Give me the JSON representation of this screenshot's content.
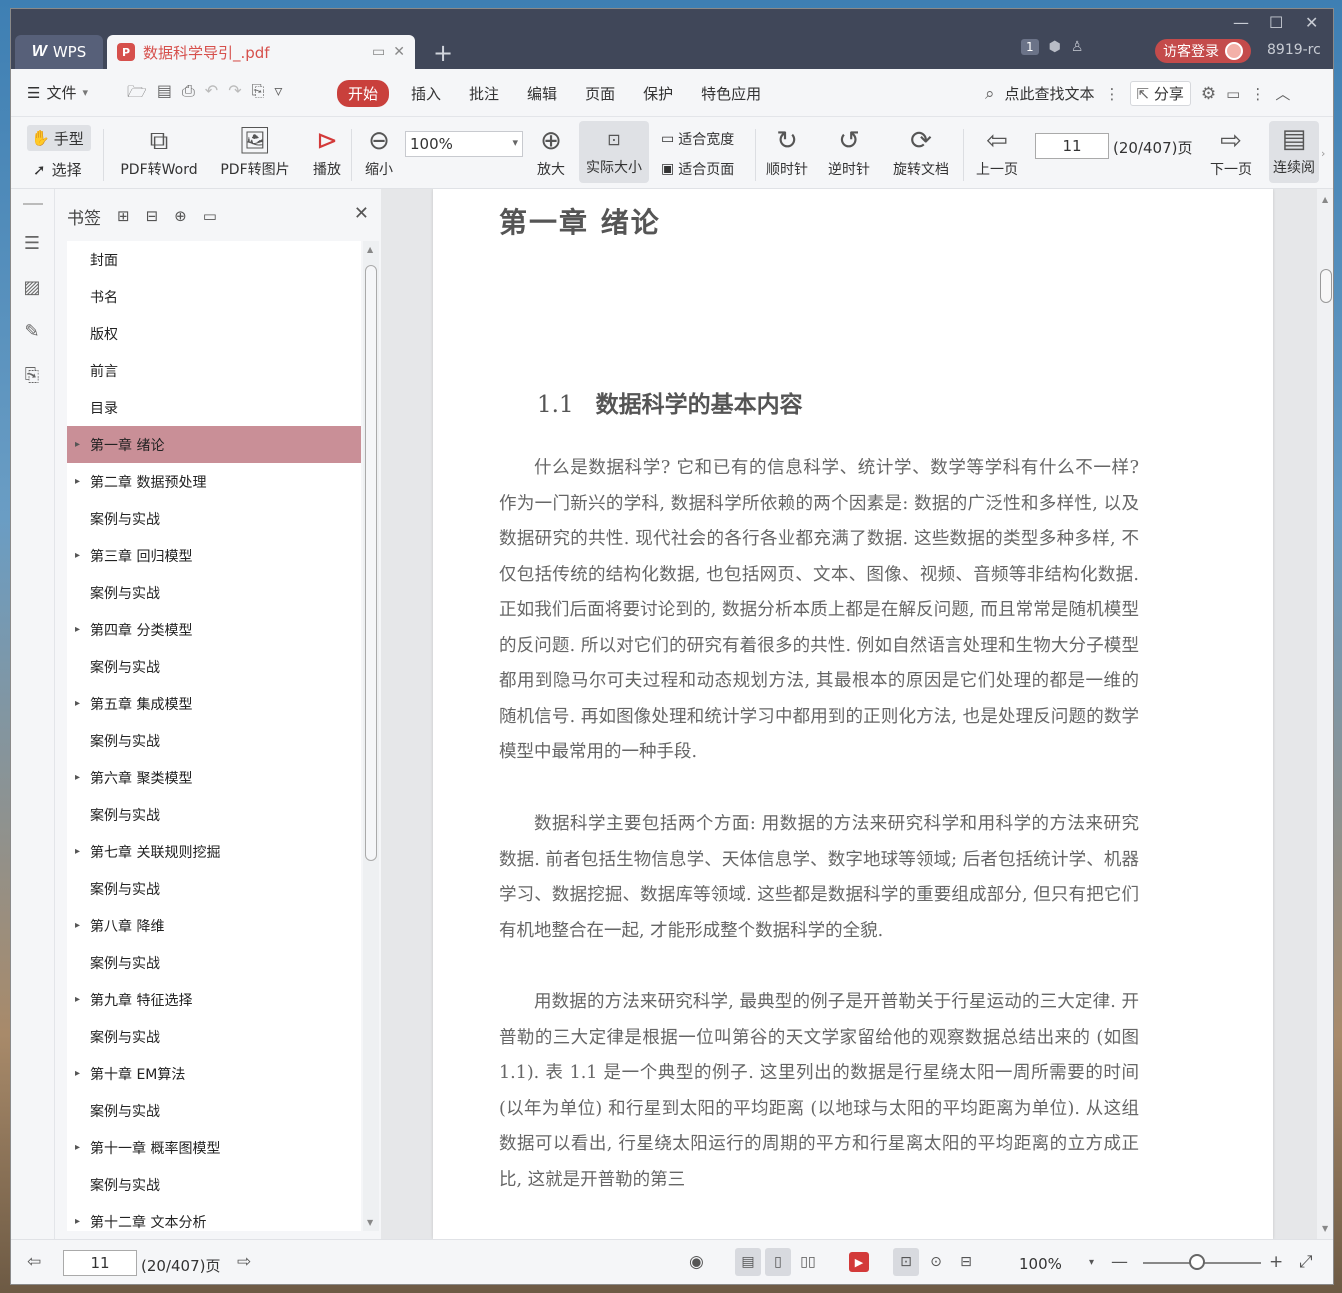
{
  "tabs": {
    "home_label": "WPS",
    "home_logo": "W",
    "doc_title": "数据科学导引_.pdf",
    "new_tab": "+"
  },
  "titlebar": {
    "badge": "1",
    "login_label": "访客登录",
    "user_id": "8919-rc"
  },
  "menu": {
    "file": "文件",
    "tabs": [
      "开始",
      "插入",
      "批注",
      "编辑",
      "页面",
      "保护",
      "特色应用"
    ],
    "search": "点此查找文本",
    "share": "分享"
  },
  "toolbar": {
    "hand": "手型",
    "select": "选择",
    "pdf_to_word": "PDF转Word",
    "pdf_to_image": "PDF转图片",
    "play": "播放",
    "zoom_out": "缩小",
    "zoom_value": "100%",
    "zoom_in": "放大",
    "actual_size": "实际大小",
    "fit_width": "适合宽度",
    "fit_page": "适合页面",
    "clockwise": "顺时针",
    "counterclockwise": "逆时针",
    "rotate_doc": "旋转文档",
    "prev_page": "上一页",
    "page_current": "11",
    "page_total": "(20/407)页",
    "next_page": "下一页",
    "continuous": "连续阅"
  },
  "bookmarks": {
    "title": "书签",
    "items": [
      {
        "label": "封面",
        "children": false
      },
      {
        "label": "书名",
        "children": false
      },
      {
        "label": "版权",
        "children": false
      },
      {
        "label": "前言",
        "children": false
      },
      {
        "label": "目录",
        "children": false
      },
      {
        "label": "第一章 绪论",
        "children": true,
        "selected": true
      },
      {
        "label": "第二章 数据预处理",
        "children": true
      },
      {
        "label": "案例与实战",
        "children": false
      },
      {
        "label": "第三章 回归模型",
        "children": true
      },
      {
        "label": "案例与实战",
        "children": false
      },
      {
        "label": "第四章 分类模型",
        "children": true
      },
      {
        "label": "案例与实战",
        "children": false
      },
      {
        "label": "第五章 集成模型",
        "children": true
      },
      {
        "label": "案例与实战",
        "children": false
      },
      {
        "label": "第六章 聚类模型",
        "children": true
      },
      {
        "label": "案例与实战",
        "children": false
      },
      {
        "label": "第七章 关联规则挖掘",
        "children": true
      },
      {
        "label": "案例与实战",
        "children": false
      },
      {
        "label": "第八章 降维",
        "children": true
      },
      {
        "label": "案例与实战",
        "children": false
      },
      {
        "label": "第九章 特征选择",
        "children": true
      },
      {
        "label": "案例与实战",
        "children": false
      },
      {
        "label": "第十章 EM算法",
        "children": true
      },
      {
        "label": "案例与实战",
        "children": false
      },
      {
        "label": "第十一章 概率图模型",
        "children": true
      },
      {
        "label": "案例与实战",
        "children": false
      },
      {
        "label": "第十二章 文本分析",
        "children": true
      }
    ]
  },
  "document": {
    "chapter_title": "第一章 绪论",
    "section_number": "1.1",
    "section_title": "数据科学的基本内容",
    "paragraphs": [
      "什么是数据科学? 它和已有的信息科学、统计学、数学等学科有什么不一样? 作为一门新兴的学科, 数据科学所依赖的两个因素是: 数据的广泛性和多样性, 以及数据研究的共性. 现代社会的各行各业都充满了数据. 这些数据的类型多种多样, 不仅包括传统的结构化数据, 也包括网页、文本、图像、视频、音频等非结构化数据. 正如我们后面将要讨论到的, 数据分析本质上都是在解反问题, 而且常常是随机模型的反问题. 所以对它们的研究有着很多的共性. 例如自然语言处理和生物大分子模型都用到隐马尔可夫过程和动态规划方法, 其最根本的原因是它们处理的都是一维的随机信号. 再如图像处理和统计学习中都用到的正则化方法, 也是处理反问题的数学模型中最常用的一种手段.",
      "数据科学主要包括两个方面: 用数据的方法来研究科学和用科学的方法来研究数据. 前者包括生物信息学、天体信息学、数字地球等领域; 后者包括统计学、机器学习、数据挖掘、数据库等领域. 这些都是数据科学的重要组成部分, 但只有把它们有机地整合在一起, 才能形成整个数据科学的全貌.",
      "用数据的方法来研究科学, 最典型的例子是开普勒关于行星运动的三大定律. 开普勒的三大定律是根据一位叫第谷的天文学家留给他的观察数据总结出来的 (如图 1.1). 表 1.1 是一个典型的例子. 这里列出的数据是行星绕太阳一周所需要的时间 (以年为单位) 和行星到太阳的平均距离 (以地球与太阳的平均距离为单位). 从这组数据可以看出, 行星绕太阳运行的周期的平方和行星离太阳的平均距离的立方成正比, 这就是开普勒的第三"
    ]
  },
  "statusbar": {
    "page_current": "11",
    "page_total": "(20/407)页",
    "zoom": "100%"
  }
}
